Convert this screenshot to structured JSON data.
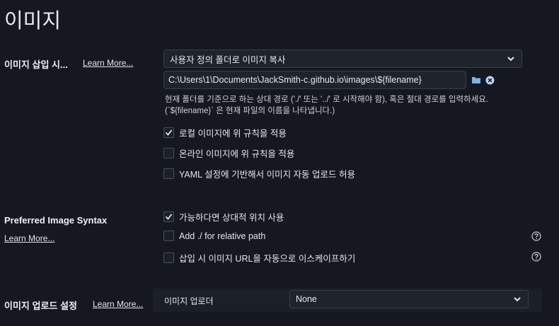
{
  "page": {
    "title": "이미지"
  },
  "insert_section": {
    "label": "이미지 삽입 시...",
    "learn_more": "Learn More...",
    "action_select": "사용자 정의 폴더로 이미지 복사",
    "path_value": "C:\\Users\\1\\Documents\\JackSmith-c.github.io\\images\\${filename}",
    "hint_line1": "현재 폴더를 기준으로 하는 상대 경로 ('./' 또는 '../' 로 시작해야 함), 혹은 절대 경로를 입력하세요.",
    "hint_line2": "(`${filename}` 은 현재 파일의 이름을 나타냅니다.)",
    "options": [
      {
        "label": "로컬 이미지에 위 규칙을 적용",
        "checked": true
      },
      {
        "label": "온라인 이미지에 위 규칙을 적용",
        "checked": false
      },
      {
        "label": "YAML 설정에 기반해서 이미지 자동 업로드 허용",
        "checked": false
      }
    ]
  },
  "syntax_section": {
    "label": "Preferred Image Syntax",
    "learn_more": "Learn More...",
    "options": [
      {
        "label": "가능하다면 상대적 위치 사용",
        "checked": true
      },
      {
        "label": "Add ./ for relative path",
        "checked": false
      },
      {
        "label": "삽입 시 이미지 URL을 자동으로 이스케이프하기",
        "checked": false
      }
    ]
  },
  "upload_section": {
    "label": "이미지 업로드 설정",
    "learn_more": "Learn More...",
    "uploader_label": "이미지 업로더",
    "uploader_value": "None"
  },
  "colors": {
    "background": "#151820",
    "checkmark": "#e6e8ec",
    "folder_icon": "#7fb2e0"
  },
  "icons": [
    "folder-icon",
    "clear-icon",
    "chevron-down-icon",
    "checkmark-icon",
    "help-icon"
  ]
}
